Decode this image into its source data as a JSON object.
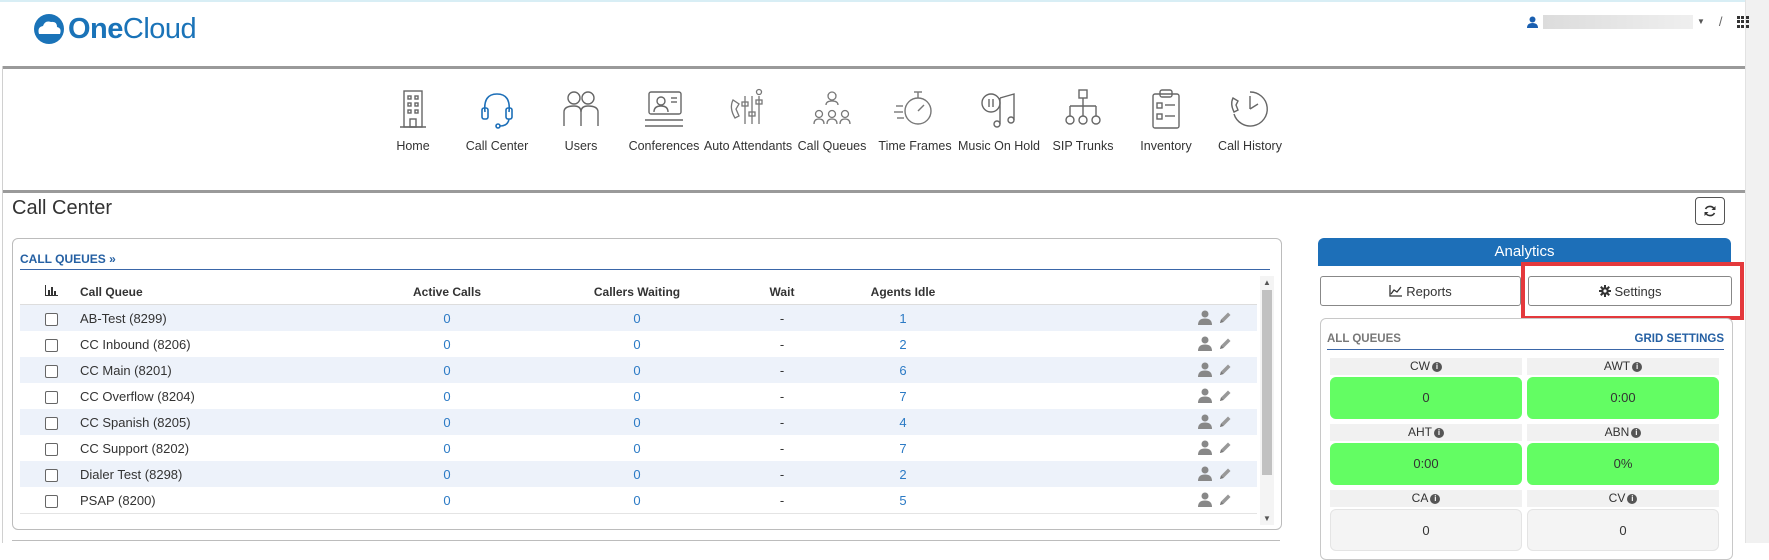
{
  "app": {
    "logo_one": "One",
    "logo_cloud": "Cloud",
    "slash": "/"
  },
  "nav": [
    {
      "label": "Home",
      "icon": "building-icon"
    },
    {
      "label": "Call Center",
      "icon": "headset-icon"
    },
    {
      "label": "Users",
      "icon": "users-icon"
    },
    {
      "label": "Conferences",
      "icon": "conference-icon"
    },
    {
      "label": "Auto Attendants",
      "icon": "auto-attendant-icon"
    },
    {
      "label": "Call Queues",
      "icon": "call-queue-icon"
    },
    {
      "label": "Time Frames",
      "icon": "stopwatch-icon"
    },
    {
      "label": "Music On Hold",
      "icon": "music-icon"
    },
    {
      "label": "SIP Trunks",
      "icon": "sip-trunk-icon"
    },
    {
      "label": "Inventory",
      "icon": "clipboard-icon"
    },
    {
      "label": "Call History",
      "icon": "call-history-icon"
    }
  ],
  "page": {
    "title": "Call Center"
  },
  "queues": {
    "heading": "CALL QUEUES",
    "columns": [
      "Call Queue",
      "Active Calls",
      "Callers Waiting",
      "Wait",
      "Agents Idle"
    ],
    "rows": [
      {
        "name": "AB-Test (8299)",
        "active": "0",
        "waiting": "0",
        "wait": "-",
        "idle": "1"
      },
      {
        "name": "CC Inbound (8206)",
        "active": "0",
        "waiting": "0",
        "wait": "-",
        "idle": "2"
      },
      {
        "name": "CC Main (8201)",
        "active": "0",
        "waiting": "0",
        "wait": "-",
        "idle": "6"
      },
      {
        "name": "CC Overflow (8204)",
        "active": "0",
        "waiting": "0",
        "wait": "-",
        "idle": "7"
      },
      {
        "name": "CC Spanish (8205)",
        "active": "0",
        "waiting": "0",
        "wait": "-",
        "idle": "4"
      },
      {
        "name": "CC Support (8202)",
        "active": "0",
        "waiting": "0",
        "wait": "-",
        "idle": "7"
      },
      {
        "name": "Dialer Test (8298)",
        "active": "0",
        "waiting": "0",
        "wait": "-",
        "idle": "2"
      },
      {
        "name": "PSAP (8200)",
        "active": "0",
        "waiting": "0",
        "wait": "-",
        "idle": "5"
      }
    ]
  },
  "analytics": {
    "title": "Analytics",
    "reports_label": "Reports",
    "settings_label": "Settings",
    "all_queues": "ALL QUEUES",
    "grid_settings": "GRID SETTINGS",
    "metrics": [
      {
        "label": "CW",
        "value": "0",
        "status": "green"
      },
      {
        "label": "AWT",
        "value": "0:00",
        "status": "green"
      },
      {
        "label": "AHT",
        "value": "0:00",
        "status": "green"
      },
      {
        "label": "ABN",
        "value": "0%",
        "status": "green"
      },
      {
        "label": "CA",
        "value": "0",
        "status": "neutral"
      },
      {
        "label": "CV",
        "value": "0",
        "status": "neutral"
      }
    ]
  },
  "colors": {
    "brand": "#1a73b8",
    "accent": "#1d6fb8",
    "link": "#2b7ac5",
    "good": "#63fd63",
    "highlight": "#e4393c"
  }
}
